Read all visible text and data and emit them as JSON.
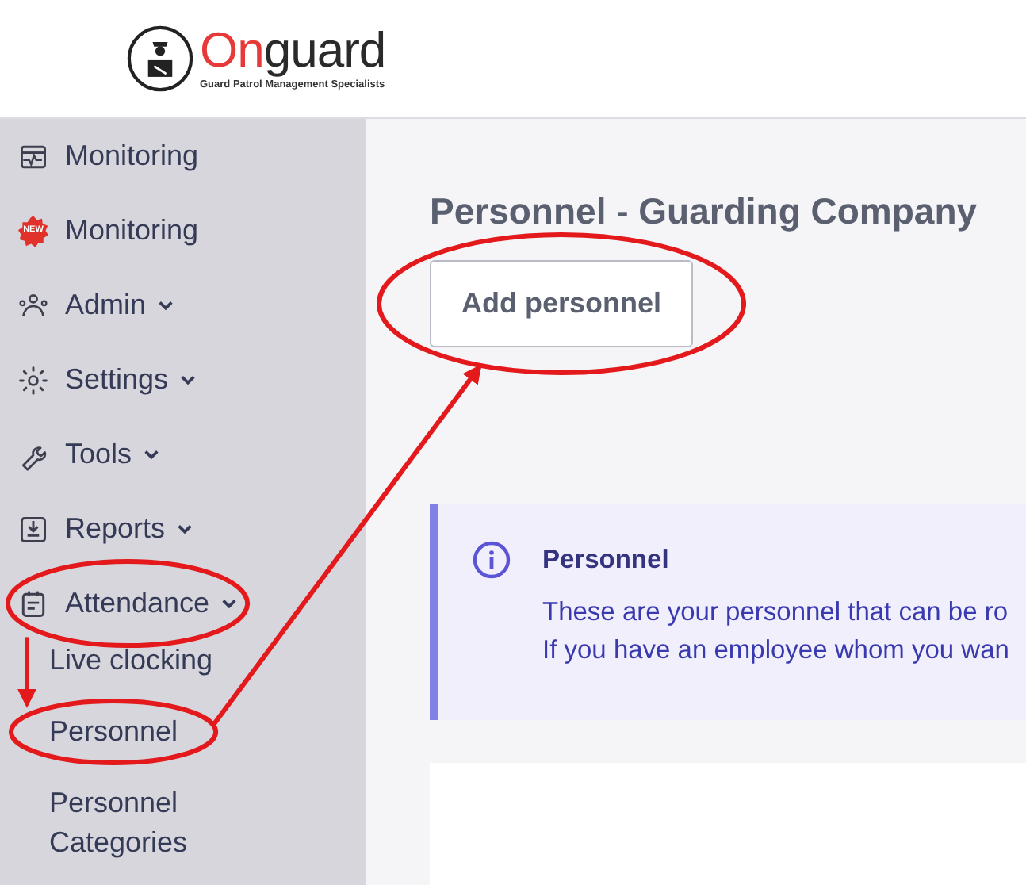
{
  "logo": {
    "name_parts": [
      {
        "text": "On",
        "color": "#e8393a"
      },
      {
        "text": "guard",
        "color": "#2a2a2a"
      }
    ],
    "tagline": "Guard Patrol Management Specialists"
  },
  "sidebar": {
    "items": [
      {
        "label": "Monitoring",
        "expandable": false,
        "highlighted": false
      },
      {
        "badge": "NEW",
        "label": "Monitoring",
        "expandable": false,
        "highlighted": false
      },
      {
        "label": "Admin",
        "expandable": true,
        "highlighted": false
      },
      {
        "label": "Settings",
        "expandable": true,
        "highlighted": false
      },
      {
        "label": "Tools",
        "expandable": true,
        "highlighted": false
      },
      {
        "label": "Reports",
        "expandable": true,
        "highlighted": false
      },
      {
        "label": "Attendance",
        "expandable": true,
        "highlighted": true,
        "children": [
          {
            "label": "Live clocking",
            "highlighted": false
          },
          {
            "label": "Personnel",
            "highlighted": true
          },
          {
            "label": "Personnel Categories",
            "highlighted": false
          }
        ]
      }
    ]
  },
  "page": {
    "title": "Personnel - Guarding Company",
    "add_button": {
      "label": "Add personnel",
      "highlighted": true
    },
    "alert": {
      "title": "Personnel",
      "lines": [
        "These are your personnel that can be ro",
        "If you have an employee whom you wan"
      ]
    }
  }
}
